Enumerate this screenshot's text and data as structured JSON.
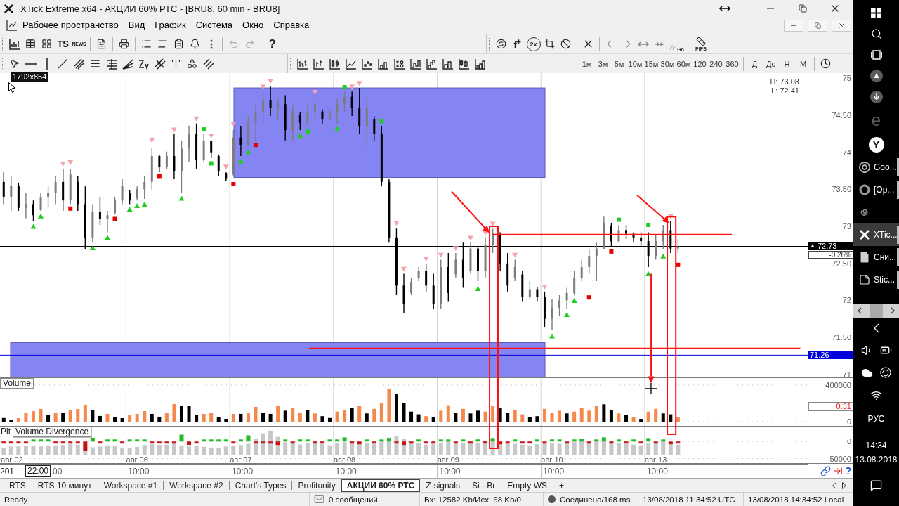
{
  "window": {
    "title": "XTick Extreme x64 - АКЦИИ 60% РТС - [BRU8, 60 min - BRU8]"
  },
  "menu": [
    "Рабочее пространство",
    "Вид",
    "График",
    "Система",
    "Окно",
    "Справка"
  ],
  "toolbar_main": {
    "ts_label": "TS",
    "news_label": "NEWS",
    "help_label": "?",
    "undo": {
      "disabled": true
    },
    "redo": {
      "disabled": true
    }
  },
  "toolbar_edit": {
    "formula_label": "f$^{+}$",
    "zoom_label": "2x",
    "go_label": "Go",
    "pips_label": "PIPS"
  },
  "timeframes": [
    "1м",
    "3м",
    "5м",
    "10м",
    "15м",
    "30м",
    "60м",
    "120",
    "240",
    "360"
  ],
  "periods": [
    "Д",
    "Дс",
    "Н",
    "М"
  ],
  "size_tooltip": "1792x854",
  "chart": {
    "panes": [
      {
        "kind": "price",
        "range_high": "H: 73.08",
        "range_low": "L: 72.41",
        "change": "-0.26%",
        "last_price_marker": "▲",
        "chart_data": {
          "type": "candlestick",
          "ylim": [
            70.95,
            75.07
          ],
          "grid": true,
          "yticks": [
            {
              "value": 75,
              "label": "75"
            },
            {
              "value": 74.5,
              "label": "74.50"
            },
            {
              "value": 74,
              "label": "74"
            },
            {
              "value": 73.5,
              "label": "73.50"
            },
            {
              "value": 73,
              "label": "73"
            },
            {
              "value": 72.5,
              "label": "72.50"
            },
            {
              "value": 72,
              "label": "72"
            },
            {
              "value": 71.5,
              "label": "71.50"
            },
            {
              "value": 71,
              "label": "71"
            }
          ],
          "ohlc": [
            [
              73.6,
              73.73,
              73.3,
              73.4
            ],
            [
              73.4,
              73.68,
              73.21,
              73.55
            ],
            [
              73.55,
              73.59,
              73.21,
              73.25
            ],
            [
              73.25,
              73.45,
              73.11,
              73.3
            ],
            [
              73.3,
              73.35,
              73.07,
              73.15
            ],
            [
              73.22,
              73.45,
              73.21,
              73.4
            ],
            [
              73.4,
              73.54,
              73.26,
              73.45
            ],
            [
              73.45,
              73.68,
              73.3,
              73.6
            ],
            [
              73.6,
              73.78,
              73.21,
              73.35
            ],
            [
              73.35,
              73.78,
              73.3,
              73.7
            ],
            [
              73.6,
              73.68,
              73.21,
              73.3
            ],
            [
              73.3,
              73.54,
              72.69,
              72.85
            ],
            [
              72.85,
              73.3,
              72.78,
              73.2
            ],
            [
              73.2,
              73.4,
              73.02,
              73.1
            ],
            [
              73.1,
              73.21,
              72.92,
              73.15
            ],
            [
              73.18,
              73.4,
              73.16,
              73.35
            ],
            [
              73.35,
              73.64,
              73.3,
              73.55
            ],
            [
              73.45,
              73.49,
              73.3,
              73.35
            ],
            [
              73.38,
              73.54,
              73.35,
              73.5
            ],
            [
              73.5,
              73.68,
              73.37,
              73.6
            ],
            [
              73.6,
              74.06,
              73.49,
              73.95
            ],
            [
              73.95,
              73.97,
              73.73,
              73.8
            ],
            [
              73.8,
              74.01,
              73.78,
              73.95
            ],
            [
              73.95,
              74.25,
              73.64,
              73.75
            ],
            [
              73.75,
              74.16,
              73.45,
              74.05
            ],
            [
              74.05,
              74.36,
              73.87,
              74.25
            ],
            [
              74.25,
              74.39,
              73.78,
              73.9
            ],
            [
              73.9,
              74.25,
              73.87,
              74.15
            ],
            [
              74.15,
              74.16,
              73.92,
              74.0
            ],
            [
              73.95,
              73.97,
              73.68,
              73.75
            ],
            [
              73.72,
              73.73,
              73.61,
              73.65
            ],
            [
              73.7,
              74.3,
              73.68,
              74.2
            ],
            [
              74.2,
              74.35,
              73.95,
              74.1
            ],
            [
              74.1,
              74.49,
              74.08,
              74.4
            ],
            [
              74.4,
              74.63,
              74.16,
              74.55
            ],
            [
              74.55,
              74.82,
              74.35,
              74.7
            ],
            [
              74.7,
              74.9,
              74.49,
              74.6
            ],
            [
              74.6,
              74.73,
              74.44,
              74.65
            ],
            [
              74.65,
              74.77,
              74.16,
              74.3
            ],
            [
              74.3,
              74.63,
              74.16,
              74.55
            ],
            [
              74.5,
              74.54,
              74.3,
              74.4
            ],
            [
              74.4,
              74.63,
              74.35,
              74.55
            ],
            [
              74.55,
              74.74,
              74.44,
              74.65
            ],
            [
              74.55,
              74.58,
              74.39,
              74.45
            ],
            [
              74.45,
              74.58,
              74.44,
              74.55
            ],
            [
              74.55,
              74.73,
              74.39,
              74.65
            ],
            [
              74.65,
              74.82,
              74.54,
              74.75
            ],
            [
              74.75,
              74.82,
              74.49,
              74.6
            ],
            [
              74.6,
              74.87,
              74.25,
              74.35
            ],
            [
              74.35,
              74.73,
              74.06,
              74.6
            ],
            [
              74.45,
              74.49,
              74.16,
              74.25
            ],
            [
              74.25,
              74.35,
              73.54,
              73.6
            ],
            [
              73.6,
              73.64,
              72.78,
              72.85
            ],
            [
              72.85,
              72.97,
              72.07,
              72.2
            ],
            [
              72.2,
              72.36,
              71.83,
              71.95
            ],
            [
              72.1,
              72.31,
              72.07,
              72.25
            ],
            [
              72.3,
              72.45,
              72.26,
              72.4
            ],
            [
              72.4,
              72.5,
              72.12,
              72.2
            ],
            [
              72.2,
              72.36,
              71.88,
              71.95
            ],
            [
              71.95,
              72.55,
              71.88,
              72.45
            ],
            [
              72.45,
              72.64,
              71.98,
              72.1
            ],
            [
              72.35,
              72.64,
              72.31,
              72.55
            ],
            [
              72.55,
              72.78,
              72.17,
              72.3
            ],
            [
              72.4,
              72.78,
              72.36,
              72.7
            ],
            [
              72.7,
              72.73,
              72.26,
              72.4
            ],
            [
              72.4,
              72.85,
              72.31,
              72.75
            ],
            [
              72.75,
              72.97,
              72.64,
              72.9
            ],
            [
              72.9,
              72.92,
              72.4,
              72.5
            ],
            [
              72.5,
              72.64,
              72.12,
              72.2
            ],
            [
              72.3,
              72.55,
              72.26,
              72.45
            ],
            [
              72.35,
              72.4,
              71.98,
              72.05
            ],
            [
              72.05,
              72.26,
              72.02,
              72.15
            ],
            [
              72.15,
              72.18,
              71.98,
              72.05
            ],
            [
              72.05,
              72.12,
              71.64,
              71.75
            ],
            [
              71.75,
              72.02,
              71.6,
              71.9
            ],
            [
              71.9,
              72.07,
              71.79,
              72.0
            ],
            [
              72.0,
              72.17,
              71.88,
              72.1
            ],
            [
              72.1,
              72.4,
              72.07,
              72.3
            ],
            [
              72.3,
              72.55,
              72.26,
              72.45
            ],
            [
              72.45,
              72.69,
              72.36,
              72.6
            ],
            [
              72.6,
              72.78,
              72.26,
              72.7
            ],
            [
              72.7,
              73.13,
              72.69,
              73.05
            ],
            [
              73.0,
              73.04,
              72.73,
              72.8
            ],
            [
              72.8,
              73.02,
              72.78,
              72.95
            ],
            [
              72.95,
              73.02,
              72.83,
              72.9
            ],
            [
              72.9,
              72.92,
              72.78,
              72.85
            ],
            [
              72.85,
              72.92,
              72.73,
              72.8
            ],
            [
              72.8,
              72.92,
              72.45,
              72.6
            ],
            [
              72.6,
              72.88,
              72.55,
              72.8
            ],
            [
              72.8,
              73.02,
              72.69,
              72.95
            ],
            [
              72.95,
              73.07,
              72.64,
              72.7
            ],
            [
              72.7,
              72.83,
              72.64,
              72.73
            ],
            null,
            null,
            null,
            null,
            null,
            null,
            null,
            null,
            null,
            null,
            null,
            null,
            null,
            null,
            null,
            null,
            null
          ],
          "ref_lines": [
            {
              "axis": "y",
              "value": 72.73,
              "label": "72.73",
              "color": "#000000",
              "line_style": "solid"
            },
            {
              "axis": "y",
              "value": 71.26,
              "label": "71.26",
              "color": "#0000dd",
              "line_style": "solid"
            }
          ],
          "series": [
            {
              "type": "scatter",
              "marker": "triangle",
              "color": "#f4a3ab",
              "values": [
                null,
                null,
                null,
                null,
                null,
                null,
                null,
                null,
                73.84,
                73.86,
                null,
                null,
                null,
                null,
                null,
                null,
                null,
                null,
                null,
                null,
                74.16,
                null,
                null,
                74.3,
                null,
                null,
                74.45,
                null,
                74.22,
                null,
                73.8,
                74.38,
                null,
                null,
                null,
                74.88,
                74.96,
                null,
                null,
                null,
                null,
                null,
                74.81,
                null,
                null,
                null,
                null,
                74.88,
                74.93,
                null,
                null,
                null,
                null,
                73.04,
                72.42,
                null,
                null,
                72.56,
                null,
                72.61,
                null,
                72.7,
                null,
                72.84,
                null,
                72.91,
                73.03,
                null,
                null,
                72.61,
                null,
                null,
                null,
                72.18,
                null,
                null,
                null,
                null,
                null,
                null,
                null,
                null,
                null,
                null,
                null,
                null,
                null,
                null,
                null,
                null,
                73.13,
                null,
                null,
                null,
                null,
                null,
                null,
                null,
                null,
                null,
                null,
                null,
                null,
                null,
                null,
                null,
                null,
                null,
                null
              ]
            },
            {
              "type": "scatter",
              "marker": "triangle",
              "color": "#1fcc1f",
              "values": [
                null,
                null,
                null,
                null,
                73.0,
                73.14,
                null,
                null,
                null,
                null,
                null,
                null,
                72.71,
                null,
                72.85,
                null,
                null,
                73.23,
                73.28,
                73.3,
                null,
                null,
                null,
                null,
                73.38,
                null,
                null,
                null,
                null,
                null,
                null,
                null,
                73.88,
                74.01,
                null,
                null,
                null,
                null,
                null,
                null,
                74.23,
                null,
                null,
                null,
                null,
                74.32,
                null,
                null,
                null,
                null,
                null,
                null,
                null,
                null,
                null,
                null,
                null,
                null,
                null,
                null,
                null,
                null,
                null,
                null,
                72.16,
                null,
                null,
                null,
                null,
                null,
                null,
                null,
                null,
                null,
                71.52,
                null,
                71.81,
                72.0,
                null,
                null,
                null,
                null,
                null,
                null,
                null,
                null,
                null,
                72.36,
                null,
                72.6,
                null,
                null,
                null,
                null,
                null,
                null,
                null,
                null,
                null,
                null,
                null,
                null,
                null,
                null,
                null,
                null,
                null,
                null,
                null
              ]
            },
            {
              "type": "scatter",
              "marker": "square",
              "color": "#e60000",
              "values": [
                null,
                null,
                null,
                null,
                null,
                null,
                null,
                null,
                null,
                73.24,
                null,
                null,
                null,
                null,
                null,
                73.1,
                null,
                null,
                null,
                null,
                null,
                73.68,
                null,
                null,
                null,
                null,
                null,
                null,
                null,
                null,
                null,
                73.57,
                null,
                null,
                74.1,
                null,
                null,
                null,
                null,
                null,
                null,
                null,
                null,
                null,
                null,
                null,
                null,
                null,
                null,
                null,
                null,
                null,
                null,
                null,
                null,
                null,
                null,
                null,
                null,
                null,
                null,
                null,
                null,
                null,
                null,
                null,
                null,
                null,
                null,
                null,
                null,
                null,
                null,
                null,
                null,
                null,
                null,
                null,
                null,
                72.04,
                null,
                null,
                72.66,
                null,
                null,
                null,
                null,
                null,
                null,
                null,
                null,
                72.48,
                null,
                null,
                null,
                null,
                null,
                null,
                null,
                null,
                null,
                null,
                null,
                null,
                null,
                null,
                null,
                null,
                null
              ]
            },
            {
              "type": "scatter",
              "marker": "square",
              "color": "#1fcc1f",
              "values": [
                null,
                null,
                null,
                null,
                null,
                null,
                null,
                null,
                null,
                null,
                null,
                null,
                null,
                null,
                null,
                null,
                null,
                null,
                null,
                null,
                null,
                null,
                null,
                null,
                null,
                null,
                null,
                74.31,
                73.85,
                null,
                null,
                null,
                null,
                null,
                null,
                null,
                null,
                null,
                null,
                null,
                null,
                74.28,
                null,
                null,
                null,
                null,
                74.88,
                null,
                null,
                null,
                null,
                74.42,
                null,
                null,
                null,
                null,
                null,
                null,
                null,
                null,
                null,
                null,
                null,
                null,
                null,
                null,
                null,
                null,
                null,
                null,
                null,
                null,
                null,
                null,
                null,
                null,
                null,
                null,
                null,
                null,
                null,
                null,
                null,
                73.09,
                null,
                null,
                null,
                73.02,
                null,
                null,
                null,
                null,
                null,
                null,
                null,
                null,
                null,
                null,
                null,
                null,
                null,
                null,
                null,
                null,
                null,
                null,
                null,
                null,
                null
              ]
            }
          ]
        }
      },
      {
        "kind": "volume",
        "title": "Volume",
        "chart_data": {
          "type": "bar",
          "ylim": [
            -54000,
            477000
          ],
          "grid": true,
          "yticks": [
            {
              "value": 400000,
              "label": "400000"
            },
            {
              "value": 0,
              "label": "0"
            }
          ],
          "values": [
            40000,
            23000,
            38000,
            92000,
            115000,
            138000,
            77000,
            100000,
            100000,
            130000,
            138000,
            185000,
            123000,
            62000,
            85000,
            46000,
            38000,
            69000,
            85000,
            115000,
            85000,
            54000,
            92000,
            192000,
            177000,
            177000,
            69000,
            85000,
            100000,
            46000,
            31000,
            85000,
            85000,
            92000,
            162000,
            100000,
            85000,
            169000,
            120000,
            150000,
            100000,
            130000,
            90000,
            60000,
            40000,
            110000,
            130000,
            150000,
            170000,
            90000,
            140000,
            200000,
            360000,
            300000,
            200000,
            110000,
            80000,
            60000,
            50000,
            120000,
            180000,
            100000,
            140000,
            90000,
            120000,
            110000,
            170000,
            150000,
            100000,
            130000,
            80000,
            50000,
            60000,
            140000,
            100000,
            120000,
            90000,
            110000,
            150000,
            120000,
            170000,
            190000,
            130000,
            90000,
            70000,
            50000,
            30000,
            110000,
            140000,
            90000,
            80000,
            50000,
            null,
            null,
            null,
            null,
            null,
            null,
            null,
            null,
            null,
            null,
            null,
            null,
            null,
            null,
            null,
            null,
            null
          ],
          "colors": [
            "#000000",
            "#000000",
            "#f5894c",
            "#f5894c",
            "#f5894c",
            "#f5894c",
            "#000000",
            "#f5894c",
            "#000000",
            "#f5894c",
            "#f5894c",
            "#f5894c",
            "#000000",
            "#000000",
            "#f5894c",
            "#000000",
            "#000000",
            "#f5894c",
            "#f5894c",
            "#f5894c",
            "#000000",
            "#000000",
            "#f5894c",
            "#f5894c",
            "#000000",
            "#000000",
            "#000000",
            "#f5894c",
            "#f5894c",
            "#000000",
            "#000000",
            "#f5894c",
            "#000000",
            "#f5894c",
            "#f5894c",
            "#000000",
            "#000000",
            "#f5894c",
            "#000000",
            "#f5894c",
            "#f5894c",
            "#000000",
            "#f5894c",
            "#000000",
            "#000000",
            "#f5894c",
            "#f5894c",
            "#000000",
            "#f5894c",
            "#000000",
            "#f5894c",
            "#f5894c",
            "#f5894c",
            "#000000",
            "#000000",
            "#000000",
            "#000000",
            "#f5894c",
            "#000000",
            "#f5894c",
            "#f5894c",
            "#000000",
            "#f5894c",
            "#000000",
            "#000000",
            "#f5894c",
            "#f5894c",
            "#000000",
            "#000000",
            "#f5894c",
            "#f5894c",
            "#000000",
            "#000000",
            "#f5894c",
            "#f5894c",
            "#f5894c",
            "#000000",
            "#f5894c",
            "#f5894c",
            "#f5894c",
            "#f5894c",
            "#000000",
            "#000000",
            "#f5894c",
            "#000000",
            "#f5894c",
            "#000000",
            "#f5894c",
            "#f5894c",
            "#000000",
            "#000000",
            "#f5894c",
            null,
            null,
            null,
            null,
            null,
            null,
            null,
            null,
            null,
            null,
            null,
            null,
            null,
            null,
            null,
            null,
            null
          ],
          "annotations": [
            "0.31"
          ]
        }
      },
      {
        "kind": "divergence",
        "title_prefix": "Pit",
        "title": "Volume Divergence",
        "chart_data": {
          "type": "bar",
          "ylim": [
            -65000,
            43500
          ],
          "grid": true,
          "yticks": [
            {
              "value": 0,
              "label": "0"
            },
            {
              "value": -50000,
              "label": "-50000"
            }
          ],
          "categories": [
            null,
            "авг 02",
            null,
            null,
            null,
            null,
            null,
            null,
            null,
            null,
            null,
            null,
            null,
            null,
            null,
            null,
            null,
            null,
            "авг 06",
            null,
            null,
            null,
            null,
            null,
            null,
            null,
            null,
            null,
            null,
            null,
            null,
            null,
            "авг 07",
            null,
            null,
            null,
            null,
            null,
            null,
            null,
            null,
            null,
            null,
            null,
            null,
            null,
            "авг 08",
            null,
            null,
            null,
            null,
            null,
            null,
            null,
            null,
            null,
            null,
            null,
            null,
            null,
            "авг 09",
            null,
            null,
            null,
            null,
            null,
            null,
            null,
            null,
            null,
            null,
            null,
            null,
            null,
            "авг 10",
            null,
            null,
            null,
            null,
            null,
            null,
            null,
            null,
            null,
            null,
            null,
            null,
            null,
            "авг 13",
            null,
            null,
            null,
            null,
            null,
            null,
            null,
            null,
            null,
            null,
            null,
            null,
            null,
            null,
            null,
            null,
            null,
            null,
            null,
            null
          ],
          "series": [
            {
              "color": "#22bb22",
              "values": [
                null,
                null,
                null,
                null,
                6000,
                6000,
                6000,
                null,
                null,
                null,
                null,
                null,
                11000,
                null,
                6000,
                6000,
                null,
                6000,
                6000,
                6000,
                null,
                null,
                null,
                null,
                20000,
                null,
                null,
                6000,
                6000,
                6000,
                6000,
                null,
                6000,
                18000,
                null,
                null,
                null,
                null,
                6000,
                null,
                6000,
                6000,
                null,
                null,
                6000,
                6000,
                12000,
                null,
                null,
                6000,
                null,
                6000,
                10000,
                null,
                null,
                null,
                6000,
                null,
                null,
                6000,
                6000,
                null,
                6000,
                null,
                6000,
                null,
                10000,
                null,
                null,
                6000,
                null,
                null,
                6000,
                null,
                6000,
                6000,
                null,
                6000,
                8000,
                null,
                6000,
                12000,
                null,
                6000,
                null,
                6000,
                null,
                10000,
                null,
                6000,
                null,
                null,
                null,
                null,
                null,
                null,
                null,
                null,
                null,
                null,
                null,
                null,
                null,
                null,
                null,
                null,
                null,
                null,
                null
              ]
            },
            {
              "color": "#cc1010",
              "values": [
                -6000,
                -6000,
                -6000,
                -6000,
                null,
                null,
                null,
                -6000,
                -6000,
                -6000,
                -6000,
                -28000,
                null,
                -6000,
                null,
                null,
                -6000,
                null,
                null,
                null,
                -6000,
                -6000,
                -6000,
                -6000,
                null,
                -10000,
                -6000,
                null,
                null,
                null,
                null,
                -6000,
                null,
                null,
                -6000,
                -6000,
                -6000,
                -10000,
                null,
                -6000,
                null,
                null,
                -6000,
                -6000,
                null,
                null,
                null,
                -6000,
                -8000,
                null,
                -6000,
                null,
                null,
                -6000,
                -10000,
                -6000,
                null,
                -6000,
                -6000,
                null,
                null,
                -6000,
                null,
                -6000,
                null,
                -6000,
                null,
                -8000,
                -6000,
                null,
                -6000,
                -6000,
                null,
                -6000,
                null,
                null,
                -6000,
                null,
                null,
                -6000,
                null,
                null,
                -6000,
                null,
                -6000,
                null,
                -6000,
                null,
                -6000,
                null,
                -8000,
                -6000,
                null,
                null,
                null,
                null,
                null,
                null,
                null,
                null,
                null,
                null,
                null,
                null,
                null,
                null,
                null,
                null,
                null
              ]
            }
          ]
        }
      }
    ],
    "time_axis": {
      "year": "201",
      "cursor_time": "22:00",
      "cut_time": "00",
      "times": [
        "10:00",
        "10:00",
        "10:00",
        "10:00",
        "10:00",
        "10:00"
      ]
    },
    "footer_help": "?"
  },
  "tabs": [
    {
      "label": "RTS",
      "selected": false
    },
    {
      "label": "RTS 10 минут",
      "selected": false
    },
    {
      "label": "Workspace #1",
      "selected": false
    },
    {
      "label": "Workspace #2",
      "selected": false
    },
    {
      "label": "Chart's Types",
      "selected": false
    },
    {
      "label": "Profitunity",
      "selected": false
    },
    {
      "label": "АКЦИИ 60% РТС",
      "selected": true
    },
    {
      "label": "Z-signals",
      "selected": false
    },
    {
      "label": "Si - Br",
      "selected": false
    },
    {
      "label": "Empty WS",
      "selected": false
    },
    {
      "label": "+",
      "selected": false
    }
  ],
  "status_bar": {
    "state": "Ready",
    "messages": "0 сообщений",
    "traffic": "Вх: 12582 Kb/Исх: 68 Kb/0",
    "connection": "Соединено/168 ms",
    "utc_time": "13/08/2018 11:34:52 UTC",
    "local_time": "13/08/2018 14:34:52 Local"
  },
  "taskbar": {
    "edge_letter": "e",
    "browser_letter": "Y",
    "apps": [
      {
        "label": "Goo...",
        "selected": false
      },
      {
        "label": "[Op...",
        "selected": false
      },
      {
        "selected": false
      },
      {
        "label": "XTic...",
        "selected": true
      },
      {
        "label": "Сни...",
        "selected": false
      },
      {
        "label": "Stic...",
        "selected": false
      }
    ],
    "language": "РУС",
    "time": "14:34",
    "date": "13.08.2018"
  }
}
